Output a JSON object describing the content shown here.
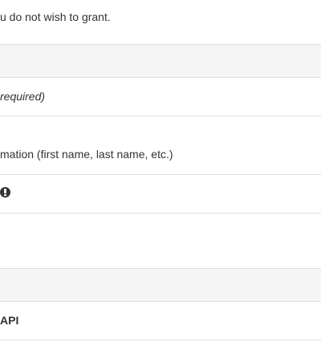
{
  "intro_text": "u do not wish to grant.",
  "section1": {
    "header": "",
    "rows": [
      {
        "text": "required)"
      },
      {
        "text": "mation (first name, last name, etc.)"
      },
      {
        "text": "",
        "icon": "exclamation-circle-icon"
      },
      {
        "text": ""
      }
    ]
  },
  "section2": {
    "header": "",
    "rows": [
      {
        "text": "API"
      }
    ]
  }
}
